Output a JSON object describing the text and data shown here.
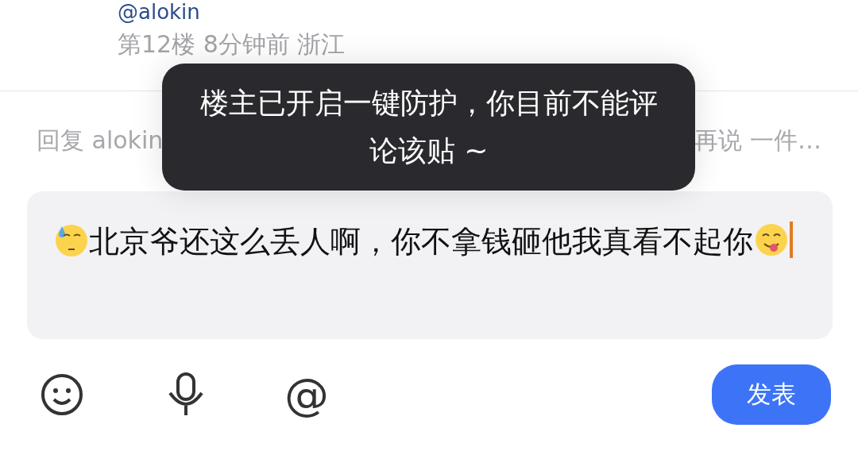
{
  "post": {
    "author": "@alokin",
    "meta": "第12楼 8分钟前 浙江"
  },
  "reply_hint": {
    "prefix": "回复 alokin",
    "suffix": "再说 一件…"
  },
  "composer": {
    "value": "北京爷还这么丢人啊，你不拿钱砸他我真看不起你"
  },
  "toolbar": {
    "mention": "@",
    "submit": "发表"
  },
  "toast": {
    "message": "楼主已开启一键防护，你目前不能评论该贴 ~"
  }
}
